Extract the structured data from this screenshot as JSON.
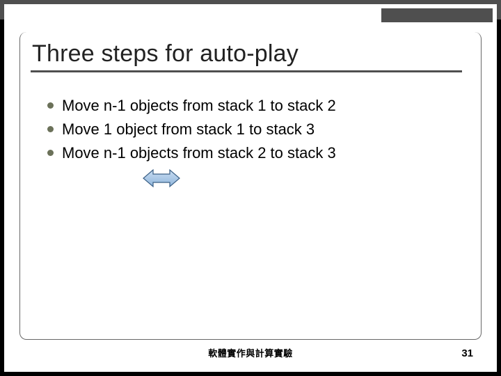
{
  "slide": {
    "title": "Three steps for auto-play",
    "bullets": [
      "Move n-1 objects from stack 1 to stack 2",
      "Move 1 object from stack 1 to stack 3",
      "Move n-1 objects from stack 2 to stack 3"
    ],
    "footer": "軟體實作與計算實驗",
    "page": "31"
  }
}
